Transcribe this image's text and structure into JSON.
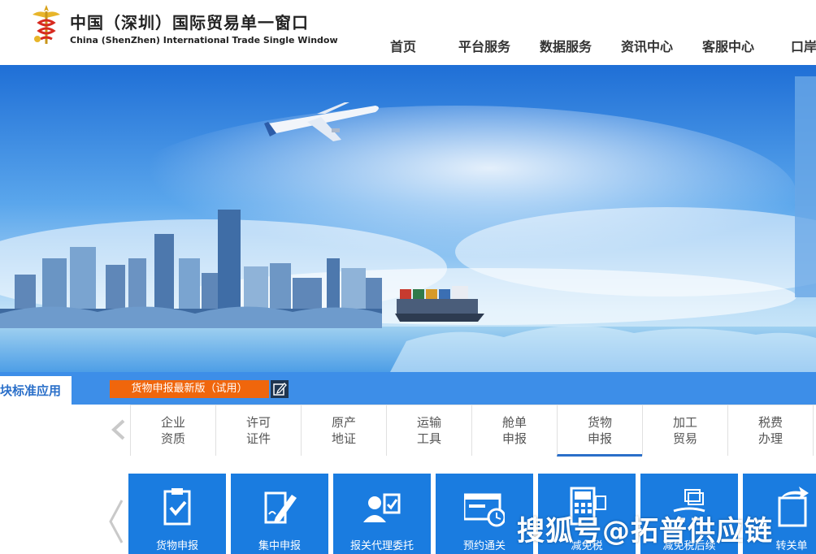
{
  "header": {
    "title_cn": "中国（深圳）国际贸易单一窗口",
    "title_en": "China (ShenZhen) International Trade Single Window",
    "logo_icon": "customs-emblem-icon",
    "nav": [
      "首页",
      "平台服务",
      "数据服务",
      "资讯中心",
      "客服中心",
      "口岸"
    ]
  },
  "tabbar": {
    "active_tab": "块标准应用",
    "promo_label": "货物申报最新版（试用）",
    "promo_icon": "edit-icon"
  },
  "categories": [
    {
      "line1": "企业",
      "line2": "资质"
    },
    {
      "line1": "许可",
      "line2": "证件"
    },
    {
      "line1": "原产",
      "line2": "地证"
    },
    {
      "line1": "运输",
      "line2": "工具"
    },
    {
      "line1": "舱单",
      "line2": "申报"
    },
    {
      "line1": "货物",
      "line2": "申报"
    },
    {
      "line1": "加工",
      "line2": "贸易"
    },
    {
      "line1": "税费",
      "line2": "办理"
    }
  ],
  "active_category": "货物申报",
  "tiles": [
    {
      "label": "货物申报",
      "icon": "clipboard-check-icon"
    },
    {
      "label": "集中申报",
      "icon": "document-pen-icon"
    },
    {
      "label": "报关代理委托",
      "icon": "agent-contract-icon"
    },
    {
      "label": "预约通关",
      "icon": "appointment-clock-icon"
    },
    {
      "label": "减免税",
      "icon": "calculator-icon"
    },
    {
      "label": "减免税后续",
      "icon": "tax-followup-icon"
    },
    {
      "label": "转关单",
      "icon": "transfer-document-icon"
    }
  ],
  "watermark": "搜狐号@拓普供应链",
  "colors": {
    "brand_blue": "#1a7ce0",
    "tab_blue": "#3d8ee8",
    "promo_orange": "#f0660c",
    "active_text": "#2a6fc9"
  }
}
